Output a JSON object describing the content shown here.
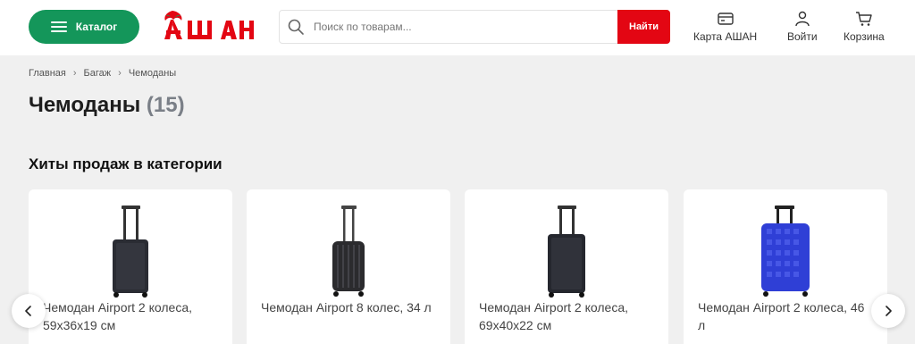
{
  "header": {
    "catalog_label": "Каталог",
    "search": {
      "placeholder": "Поиск по товарам...",
      "button_label": "Найти"
    },
    "actions": [
      {
        "label": "Карта АШАН",
        "icon": "card-icon"
      },
      {
        "label": "Войти",
        "icon": "user-icon"
      },
      {
        "label": "Корзина",
        "icon": "cart-icon"
      }
    ]
  },
  "breadcrumb": [
    "Главная",
    "Багаж",
    "Чемоданы"
  ],
  "page": {
    "title": "Чемоданы",
    "count": "(15)"
  },
  "section_title": "Хиты продаж в категории",
  "products": [
    {
      "name": "Чемодан Airport 2 колеса, 59x36x19 см",
      "color": "#2a2c33"
    },
    {
      "name": "Чемодан Airport 8 колес, 34 л",
      "color": "#2b2b2e"
    },
    {
      "name": "Чемодан Airport 2 колеса, 69x40x22 см",
      "color": "#25272e"
    },
    {
      "name": "Чемодан Airport 2 колеса, 46 л",
      "color": "#2f3fd6"
    }
  ],
  "colors": {
    "brand_green": "#14965a",
    "brand_red": "#e30613"
  }
}
